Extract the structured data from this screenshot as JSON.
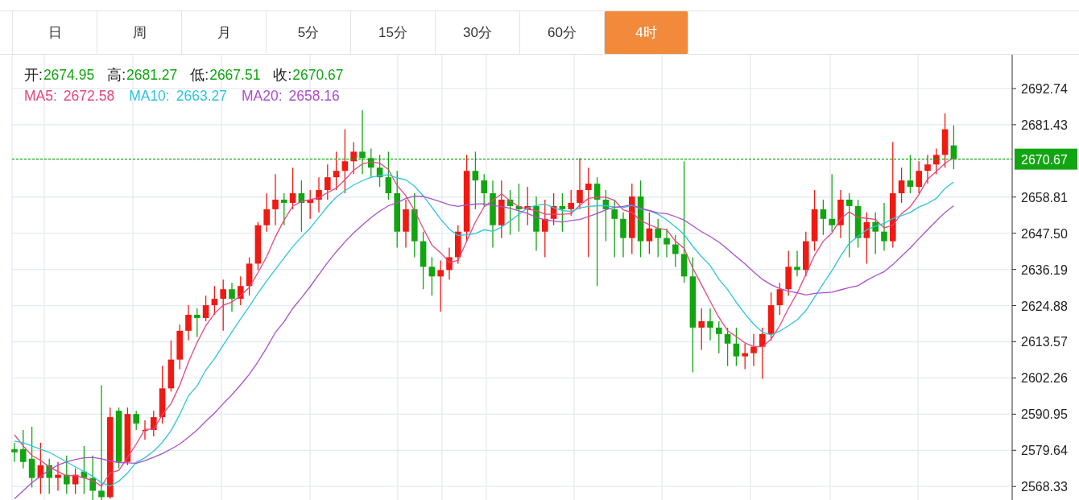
{
  "tabs": [
    {
      "label": "日",
      "selected": false
    },
    {
      "label": "周",
      "selected": false
    },
    {
      "label": "月",
      "selected": false
    },
    {
      "label": "5分",
      "selected": false
    },
    {
      "label": "15分",
      "selected": false
    },
    {
      "label": "30分",
      "selected": false
    },
    {
      "label": "60分",
      "selected": false
    },
    {
      "label": "4时",
      "selected": true
    }
  ],
  "legend": {
    "ohlc": [
      {
        "label": "开:",
        "value": "2674.95"
      },
      {
        "label": "高:",
        "value": "2681.27"
      },
      {
        "label": "低:",
        "value": "2667.51"
      },
      {
        "label": "收:",
        "value": "2670.67"
      }
    ],
    "ma_values": [
      "2672.58",
      "2663.27",
      "2658.16"
    ]
  },
  "chart": {
    "chart_data": {
      "type": "candlestick",
      "grid": true,
      "ylim": [
        2563.6,
        2703.3
      ],
      "yticks": [
        {
          "value": 2692.74,
          "label": "2692.74"
        },
        {
          "value": 2681.43,
          "label": "2681.43"
        },
        {
          "value": 2658.81,
          "label": "2658.81"
        },
        {
          "value": 2647.5,
          "label": "2647.50"
        },
        {
          "value": 2636.19,
          "label": "2636.19"
        },
        {
          "value": 2624.88,
          "label": "2624.88"
        },
        {
          "value": 2613.57,
          "label": "2613.57"
        },
        {
          "value": 2602.26,
          "label": "2602.26"
        },
        {
          "value": 2590.95,
          "label": "2590.95"
        },
        {
          "value": 2579.64,
          "label": "2579.64"
        },
        {
          "value": 2568.33,
          "label": "2568.33"
        }
      ],
      "ref_lines": [
        {
          "axis": "y",
          "value": 2670.67,
          "label": "2670.67",
          "color": "#12a512"
        }
      ],
      "series": [
        {
          "name": "MA5:",
          "type": "line",
          "color": "#e8467c",
          "values": [
            2584.5,
            2581,
            2578,
            2576.5,
            2574.4,
            2573,
            2571.6,
            2571.8,
            2571,
            2570.2,
            2568.4,
            2572.6,
            2573.4,
            2577.4,
            2581.6,
            2586.2,
            2586.2,
            2590.8,
            2594.2,
            2600,
            2607.2,
            2613.4,
            2618.6,
            2622.4,
            2625,
            2626,
            2628,
            2630.6,
            2635.2,
            2640.2,
            2646.4,
            2651.6,
            2656,
            2657.4,
            2658,
            2658.6,
            2660.2,
            2661.6,
            2664.2,
            2667.2,
            2669.2,
            2669.8,
            2669.4,
            2667.4,
            2662.4,
            2659.2,
            2654.6,
            2649,
            2643.8,
            2641.4,
            2638.4,
            2639,
            2645,
            2651,
            2655.8,
            2657.8,
            2659.8,
            2657.6,
            2655.8,
            2655,
            2654.6,
            2653.4,
            2653.4,
            2653.4,
            2653.6,
            2656.2,
            2658.4,
            2658.8,
            2658.8,
            2657.8,
            2654.8,
            2654,
            2651.4,
            2650.2,
            2649,
            2648.6,
            2645,
            2642.8,
            2636.6,
            2631.4,
            2626.2,
            2621.2,
            2617,
            2615.2,
            2613.2,
            2612,
            2612,
            2614.4,
            2618.6,
            2624,
            2628.8,
            2634.6,
            2640.6,
            2645,
            2647.6,
            2652,
            2654.2,
            2652.4,
            2652.2,
            2651.8,
            2649.2,
            2650,
            2653.6,
            2655.8,
            2659.6,
            2664.4,
            2666.8,
            2669.4,
            2671.2
          ]
        },
        {
          "name": "MA10:",
          "type": "line",
          "color": "#2fc4dc",
          "values": [
            2582.5,
            2582,
            2581,
            2580,
            2579,
            2577.5,
            2576,
            2574.5,
            2573,
            2571.5,
            2569.5,
            2568.5,
            2570,
            2572.5,
            2575.9,
            2577.3,
            2579.4,
            2582.1,
            2585.8,
            2590.8,
            2596.7,
            2599.8,
            2604.7,
            2608.3,
            2612.5,
            2616.6,
            2620.7,
            2624.6,
            2628.8,
            2632.6,
            2636.2,
            2639.8,
            2643.3,
            2646.3,
            2649.1,
            2652.5,
            2655.9,
            2658.8,
            2660.8,
            2662.6,
            2663.9,
            2665,
            2665.5,
            2665.8,
            2664.8,
            2664.2,
            2662.2,
            2659.2,
            2655.6,
            2651.9,
            2648.8,
            2646.8,
            2647,
            2647.4,
            2648.6,
            2648.1,
            2649.4,
            2651.3,
            2653.4,
            2655.4,
            2656.2,
            2656.6,
            2655.5,
            2654.6,
            2654.3,
            2655.4,
            2655.9,
            2656.1,
            2656.1,
            2655.7,
            2655.5,
            2656.2,
            2655.1,
            2654.5,
            2653.4,
            2651.7,
            2649.5,
            2647.1,
            2643.4,
            2640.2,
            2637.4,
            2633.1,
            2629.9,
            2625.9,
            2622.3,
            2619.1,
            2616.6,
            2615.7,
            2616.9,
            2618.6,
            2620.4,
            2623.3,
            2627.5,
            2631.8,
            2635.8,
            2640.4,
            2644.4,
            2646.5,
            2648.6,
            2649.7,
            2650.6,
            2652.1,
            2653,
            2654,
            2655.7,
            2656.8,
            2658.4,
            2661.5,
            2663.5
          ]
        },
        {
          "name": "MA20:",
          "type": "line",
          "color": "#ab4fc9",
          "values": [
            2564.5,
            2567,
            2569.5,
            2571.5,
            2573.5,
            2575,
            2576,
            2576.8,
            2577.3,
            2577.4,
            2577,
            2576.3,
            2575.8,
            2575.7,
            2575.6,
            2576.4,
            2577.5,
            2578.6,
            2580,
            2581.6,
            2583.7,
            2586,
            2588.7,
            2591.3,
            2594.2,
            2597,
            2600.1,
            2603.4,
            2607.3,
            2611.7,
            2616.5,
            2619.8,
            2624,
            2627.3,
            2630.8,
            2634.6,
            2638.3,
            2641.7,
            2644.8,
            2647.6,
            2650.1,
            2652.4,
            2654.4,
            2656.1,
            2657,
            2658.4,
            2659.1,
            2659,
            2658.2,
            2657.3,
            2656.4,
            2655.9,
            2656.3,
            2656.6,
            2656.7,
            2656.2,
            2655.8,
            2655.3,
            2654.5,
            2653.7,
            2652.5,
            2651.7,
            2651.3,
            2651,
            2651.5,
            2651.8,
            2652.7,
            2653.7,
            2654.8,
            2655.6,
            2655.9,
            2656.4,
            2655.3,
            2654.6,
            2653.9,
            2653.6,
            2652.7,
            2651.6,
            2649.8,
            2648,
            2646.5,
            2644.7,
            2642.5,
            2640.2,
            2637.9,
            2635.4,
            2633.1,
            2631.4,
            2630.2,
            2629.4,
            2628.9,
            2628.2,
            2628.7,
            2628.9,
            2629.1,
            2629.8,
            2630.5,
            2631.1,
            2632.8,
            2634.2,
            2635.5,
            2637.7,
            2640.3,
            2642.9,
            2645.8,
            2648.6,
            2651.4,
            2654,
            2656.1
          ]
        }
      ],
      "ohlc": [
        [
          2580,
          2582,
          2576,
          2579
        ],
        [
          2580,
          2586,
          2574,
          2576
        ],
        [
          2577,
          2587,
          2568,
          2571
        ],
        [
          2571,
          2582,
          2566,
          2575
        ],
        [
          2575,
          2577,
          2566,
          2571
        ],
        [
          2571,
          2576,
          2567,
          2572
        ],
        [
          2572,
          2578,
          2566,
          2569
        ],
        [
          2569,
          2574,
          2566,
          2572
        ],
        [
          2573,
          2581,
          2566,
          2571
        ],
        [
          2571,
          2578,
          2564,
          2567
        ],
        [
          2567,
          2600,
          2564,
          2565
        ],
        [
          2565,
          2593,
          2564.5,
          2590
        ],
        [
          2592,
          2593,
          2574,
          2576
        ],
        [
          2576,
          2593,
          2575,
          2591
        ],
        [
          2591,
          2592,
          2586,
          2588
        ],
        [
          2586,
          2589,
          2583,
          2586
        ],
        [
          2586,
          2592,
          2584,
          2590
        ],
        [
          2590,
          2606,
          2588,
          2599
        ],
        [
          2599,
          2614,
          2598,
          2608
        ],
        [
          2608,
          2619,
          2605,
          2617
        ],
        [
          2617,
          2625,
          2614,
          2622
        ],
        [
          2622,
          2624,
          2615,
          2621
        ],
        [
          2621,
          2628,
          2620,
          2625
        ],
        [
          2625,
          2631,
          2622,
          2627
        ],
        [
          2627,
          2633,
          2617,
          2630
        ],
        [
          2630,
          2632,
          2623,
          2627
        ],
        [
          2627,
          2634,
          2625,
          2631
        ],
        [
          2631,
          2640,
          2628,
          2638
        ],
        [
          2638,
          2651,
          2636,
          2650
        ],
        [
          2650,
          2660,
          2648,
          2655
        ],
        [
          2655,
          2666,
          2650,
          2658
        ],
        [
          2658,
          2660,
          2650,
          2657
        ],
        [
          2657,
          2668,
          2655,
          2660
        ],
        [
          2660,
          2664,
          2648,
          2657
        ],
        [
          2657,
          2661,
          2652,
          2658
        ],
        [
          2658,
          2665,
          2654,
          2661
        ],
        [
          2661,
          2669,
          2658,
          2665
        ],
        [
          2665,
          2673,
          2661,
          2667
        ],
        [
          2667,
          2680,
          2660,
          2670
        ],
        [
          2670,
          2676,
          2666,
          2673
        ],
        [
          2673,
          2686,
          2666,
          2671
        ],
        [
          2671,
          2674,
          2665,
          2668
        ],
        [
          2668,
          2672,
          2662,
          2665
        ],
        [
          2665,
          2673,
          2658,
          2660
        ],
        [
          2660,
          2667,
          2643,
          2648
        ],
        [
          2648,
          2658,
          2643,
          2655
        ],
        [
          2655,
          2660,
          2640,
          2645
        ],
        [
          2645,
          2648,
          2630,
          2637
        ],
        [
          2637,
          2640,
          2628,
          2634
        ],
        [
          2634,
          2639,
          2623,
          2636
        ],
        [
          2636,
          2643,
          2633,
          2640
        ],
        [
          2640,
          2650,
          2638,
          2648
        ],
        [
          2648,
          2672,
          2645,
          2667
        ],
        [
          2667,
          2673,
          2655,
          2664
        ],
        [
          2664,
          2666,
          2656,
          2660
        ],
        [
          2660,
          2664,
          2643,
          2650
        ],
        [
          2650,
          2664,
          2646,
          2658
        ],
        [
          2658,
          2661,
          2647,
          2656
        ],
        [
          2656,
          2663,
          2648,
          2655
        ],
        [
          2655,
          2662,
          2650,
          2656
        ],
        [
          2656,
          2659,
          2642,
          2648
        ],
        [
          2648,
          2658,
          2640,
          2652
        ],
        [
          2652,
          2660,
          2650,
          2656
        ],
        [
          2656,
          2660,
          2648,
          2655
        ],
        [
          2655,
          2661,
          2653,
          2657
        ],
        [
          2657,
          2671,
          2655,
          2661
        ],
        [
          2661,
          2668,
          2640,
          2663
        ],
        [
          2663,
          2665,
          2631,
          2658
        ],
        [
          2658,
          2661,
          2645,
          2655
        ],
        [
          2655,
          2658,
          2640,
          2652
        ],
        [
          2652,
          2654,
          2640,
          2646
        ],
        [
          2646,
          2663,
          2641,
          2659
        ],
        [
          2659,
          2664,
          2640,
          2645
        ],
        [
          2645,
          2654,
          2641,
          2649
        ],
        [
          2649,
          2652,
          2640,
          2646
        ],
        [
          2646,
          2649,
          2640,
          2644
        ],
        [
          2644,
          2647,
          2637,
          2641
        ],
        [
          2641,
          2670,
          2632,
          2634
        ],
        [
          2634,
          2640,
          2604,
          2618
        ],
        [
          2618,
          2624,
          2611,
          2620
        ],
        [
          2620,
          2624,
          2614,
          2618
        ],
        [
          2618,
          2620,
          2610,
          2616
        ],
        [
          2616,
          2618,
          2606,
          2613
        ],
        [
          2613,
          2618,
          2606,
          2609
        ],
        [
          2609,
          2613,
          2605,
          2610
        ],
        [
          2610,
          2616,
          2606,
          2612
        ],
        [
          2612,
          2618,
          2602,
          2616
        ],
        [
          2616,
          2629,
          2614,
          2625
        ],
        [
          2625,
          2632,
          2622,
          2630
        ],
        [
          2630,
          2642,
          2628,
          2637
        ],
        [
          2637,
          2642,
          2634,
          2636
        ],
        [
          2636,
          2648,
          2634,
          2645
        ],
        [
          2645,
          2661,
          2642,
          2655
        ],
        [
          2655,
          2658,
          2647,
          2652
        ],
        [
          2652,
          2666,
          2648,
          2650
        ],
        [
          2650,
          2661,
          2646,
          2658
        ],
        [
          2658,
          2660,
          2640,
          2656
        ],
        [
          2656,
          2658,
          2643,
          2646
        ],
        [
          2646,
          2654,
          2638,
          2651
        ],
        [
          2651,
          2654,
          2641,
          2648
        ],
        [
          2648,
          2657,
          2642,
          2645
        ],
        [
          2645,
          2676,
          2643,
          2660
        ],
        [
          2660,
          2668,
          2657,
          2664
        ],
        [
          2664,
          2672,
          2660,
          2662
        ],
        [
          2662,
          2670,
          2660,
          2667
        ],
        [
          2667,
          2672,
          2663,
          2669
        ],
        [
          2669,
          2674,
          2666,
          2672
        ],
        [
          2672,
          2685,
          2668,
          2680
        ],
        [
          2674.95,
          2681.27,
          2667.51,
          2670.67
        ]
      ]
    }
  }
}
